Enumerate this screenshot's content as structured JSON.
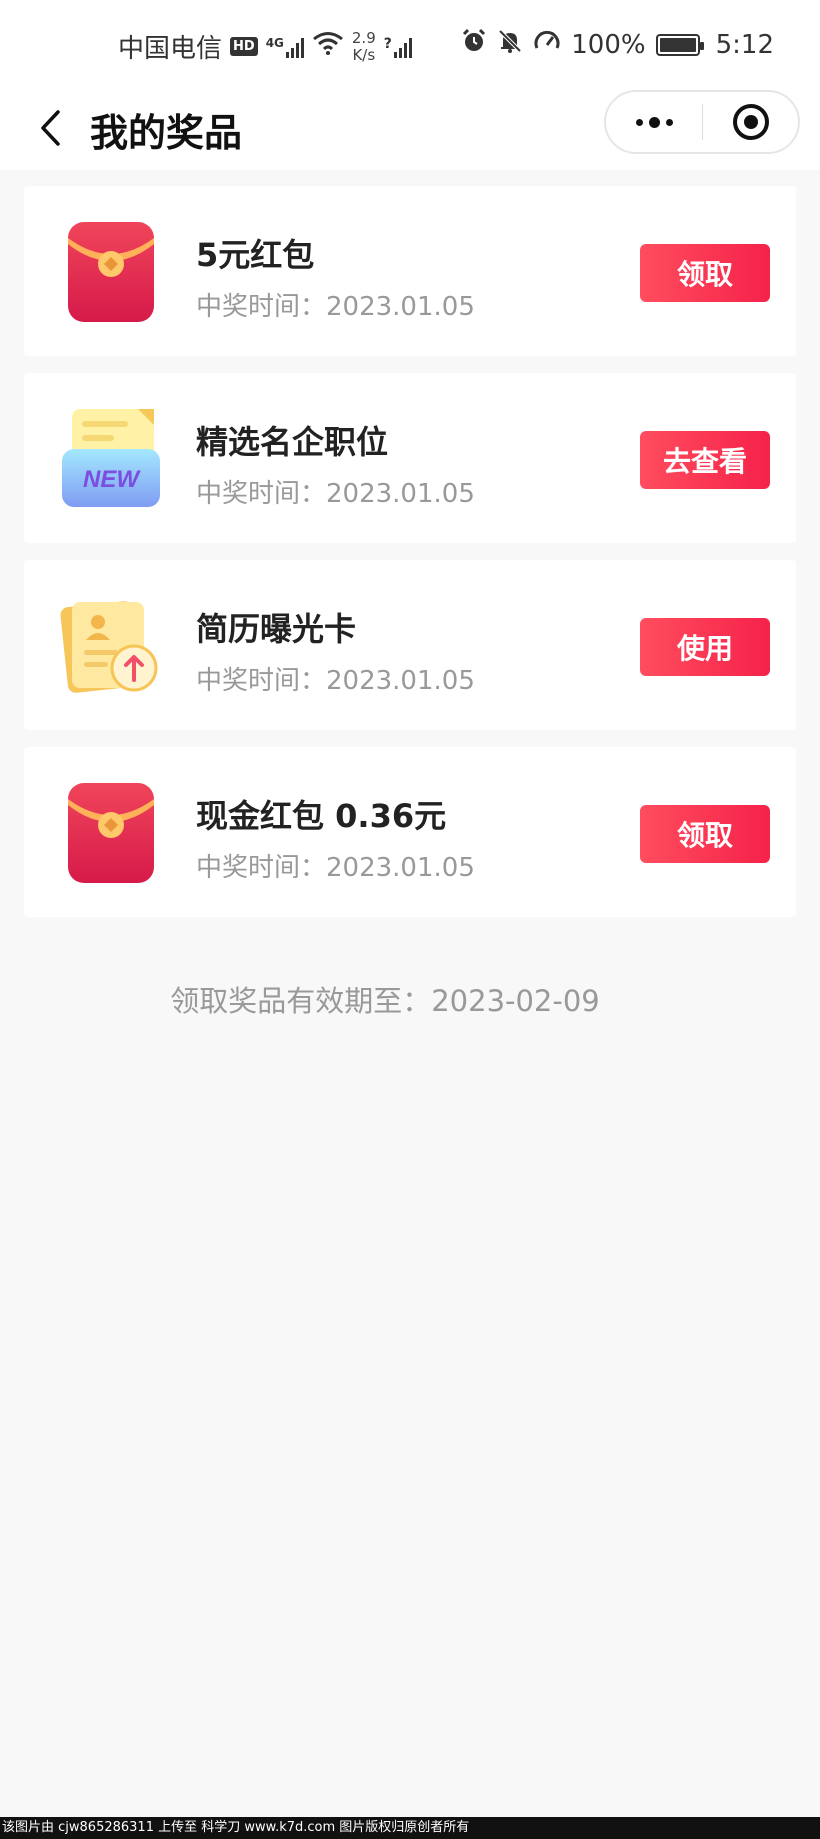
{
  "status_bar": {
    "carrier": "中国电信",
    "hd": "HD",
    "net_type": "4G",
    "speed_value": "2.9",
    "speed_unit": "K/s",
    "battery": "100%",
    "time": "5:12"
  },
  "nav": {
    "title": "我的奖品"
  },
  "prizes": [
    {
      "name": "5元红包",
      "time": "中奖时间：2023.01.05",
      "action": "领取",
      "icon": "red-envelope-icon"
    },
    {
      "name": "精选名企职位",
      "time": "中奖时间：2023.01.05",
      "action": "去查看",
      "icon": "new-folder-icon",
      "icon_text": "NEW"
    },
    {
      "name": "简历曝光卡",
      "time": "中奖时间：2023.01.05",
      "action": "使用",
      "icon": "resume-card-icon"
    },
    {
      "name": "现金红包 0.36元",
      "time": "中奖时间：2023.01.05",
      "action": "领取",
      "icon": "red-envelope-icon"
    }
  ],
  "validity": "领取奖品有效期至：2023-02-09",
  "watermark": "该图片由 cjw865286311 上传至 科学刀 www.k7d.com 图片版权归原创者所有",
  "colors": {
    "button": "#f5224a",
    "background": "#f8f8f8",
    "muted_text": "#999999"
  }
}
